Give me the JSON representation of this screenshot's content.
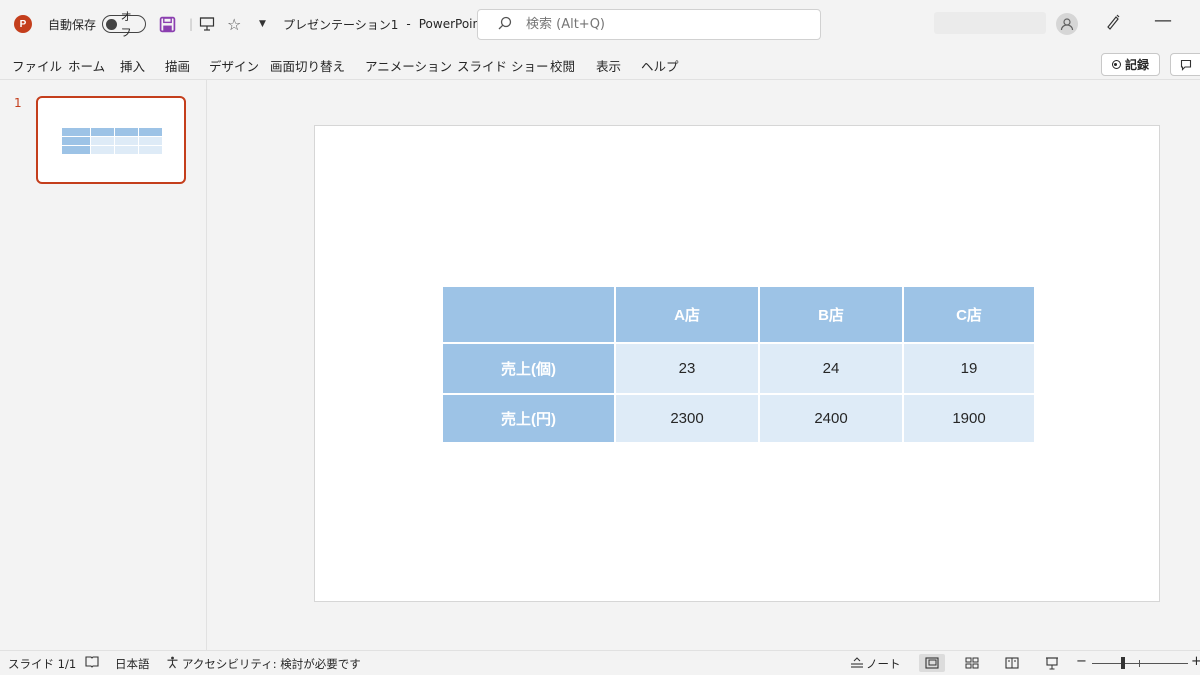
{
  "titlebar": {
    "autosave_label": "自動保存",
    "autosave_toggle": "オフ",
    "doc_title": "プレゼンテーション1",
    "separator": "-",
    "app_name": "PowerPoint",
    "search_placeholder": "検索 (Alt+Q)",
    "logo_letter": "P"
  },
  "menu": {
    "items": [
      "ファイル",
      "ホーム",
      "挿入",
      "描画",
      "デザイン",
      "画面切り替え",
      "アニメーション",
      "スライド ショー",
      "校閲",
      "表示",
      "ヘルプ"
    ],
    "record_label": "記録"
  },
  "thumbnails": {
    "slide_number": "1"
  },
  "slide": {
    "table": {
      "headers": [
        "",
        "A店",
        "B店",
        "C店"
      ],
      "rows": [
        {
          "label": "売上(個)",
          "values": [
            "23",
            "24",
            "19"
          ]
        },
        {
          "label": "売上(円)",
          "values": [
            "2300",
            "2400",
            "1900"
          ]
        }
      ]
    }
  },
  "statusbar": {
    "slide_count": "スライド 1/1",
    "language": "日本語",
    "accessibility": "アクセシビリティ: 検討が必要です",
    "notes_label": "ノート",
    "zoom_minus": "−",
    "zoom_plus": "+"
  },
  "colors": {
    "accent": "#c43e1c",
    "table_header": "#9dc3e6",
    "table_cell": "#deebf7"
  }
}
